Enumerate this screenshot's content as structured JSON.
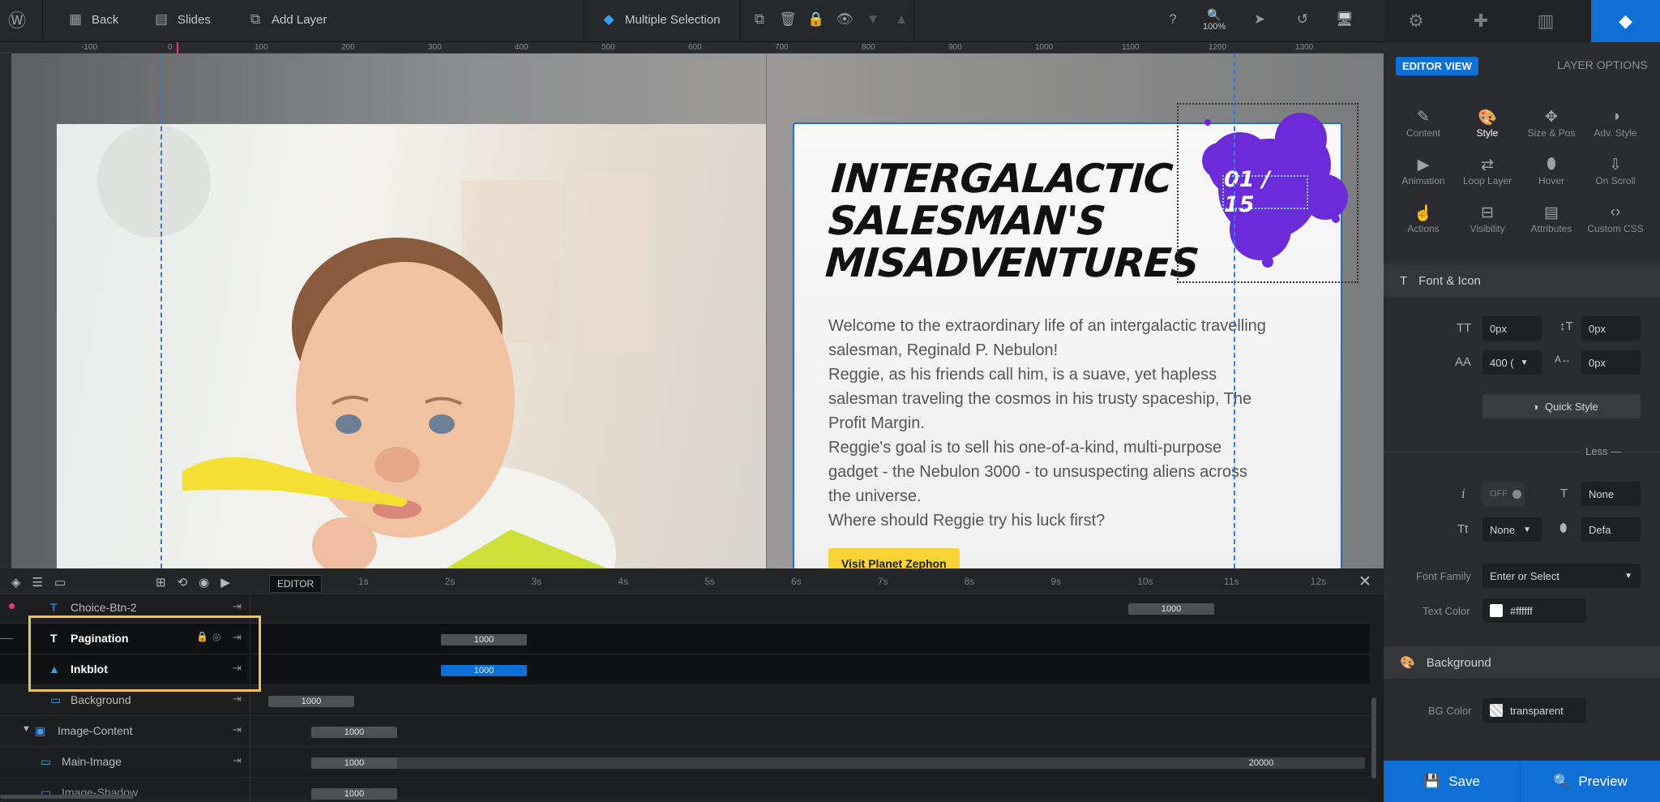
{
  "toolbar": {
    "back": "Back",
    "slides": "Slides",
    "add_layer": "Add Layer",
    "selection": "Multiple Selection",
    "zoom": "100%"
  },
  "ruler": {
    "h_ticks": [
      "-100",
      "0",
      "100",
      "200",
      "300",
      "400",
      "500",
      "600",
      "700",
      "800",
      "900",
      "1000",
      "1100",
      "1200",
      "1300"
    ]
  },
  "slide": {
    "title_lines": [
      "Intergalactic",
      "Salesman's",
      "Misadventures"
    ],
    "pagination": "01 / 15",
    "body_lines": [
      "Welcome to the extraordinary life of an intergalactic travelling",
      "salesman, Reginald P. Nebulon!",
      "Reggie, as his friends call him, is a suave, yet hapless",
      "salesman traveling the cosmos in his trusty spaceship, The",
      "Profit Margin.",
      "Reggie's goal is to sell his one-of-a-kind, multi-purpose",
      "gadget - the Nebulon 3000 - to unsuspecting aliens across",
      "the universe.",
      "Where should Reggie try his luck first?"
    ],
    "cta": "Visit Planet Zephon"
  },
  "timeline": {
    "editor_label": "EDITOR",
    "seconds": [
      "1s",
      "2s",
      "3s",
      "4s",
      "5s",
      "6s",
      "7s",
      "8s",
      "9s",
      "10s",
      "11s",
      "12s"
    ],
    "layers": [
      {
        "name": "Choice-Btn-2",
        "bar": "1000"
      },
      {
        "name": "Pagination",
        "bar": "1000"
      },
      {
        "name": "Inkblot",
        "bar": "1000"
      },
      {
        "name": "Background",
        "bar": "1000"
      },
      {
        "name": "Image-Content",
        "bar": "1000"
      },
      {
        "name": "Main-Image",
        "bar": "1000",
        "bar2": "20000"
      },
      {
        "name": "Image-Shadow",
        "bar": "1000"
      }
    ]
  },
  "panel": {
    "editor_view": "EDITOR VIEW",
    "layer_options": "LAYER OPTIONS",
    "options": [
      "Content",
      "Style",
      "Size & Pos",
      "Adv. Style",
      "Animation",
      "Loop Layer",
      "Hover",
      "On Scroll",
      "Actions",
      "Visibility",
      "Attributes",
      "Custom CSS"
    ],
    "font_icon": "Font & Icon",
    "fields": {
      "f1": "0px",
      "f2": "0px",
      "weight": "400 (",
      "f4": "0px"
    },
    "quick_style": "Quick Style",
    "less": "Less",
    "toggle": "OFF",
    "none1": "None",
    "none2": "None",
    "defa": "Defa",
    "font_family_label": "Font Family",
    "font_family_value": "Enter or Select",
    "text_color_label": "Text Color",
    "text_color_value": "#ffffff",
    "background": "Background",
    "bg_color_label": "BG Color",
    "bg_color_value": "transparent",
    "save": "Save",
    "preview": "Preview"
  },
  "colors": {
    "accent": "#0e6fd6",
    "inkblot": "#6b2bd9",
    "cta": "#f7d433",
    "highlight": "#e8c84a"
  }
}
